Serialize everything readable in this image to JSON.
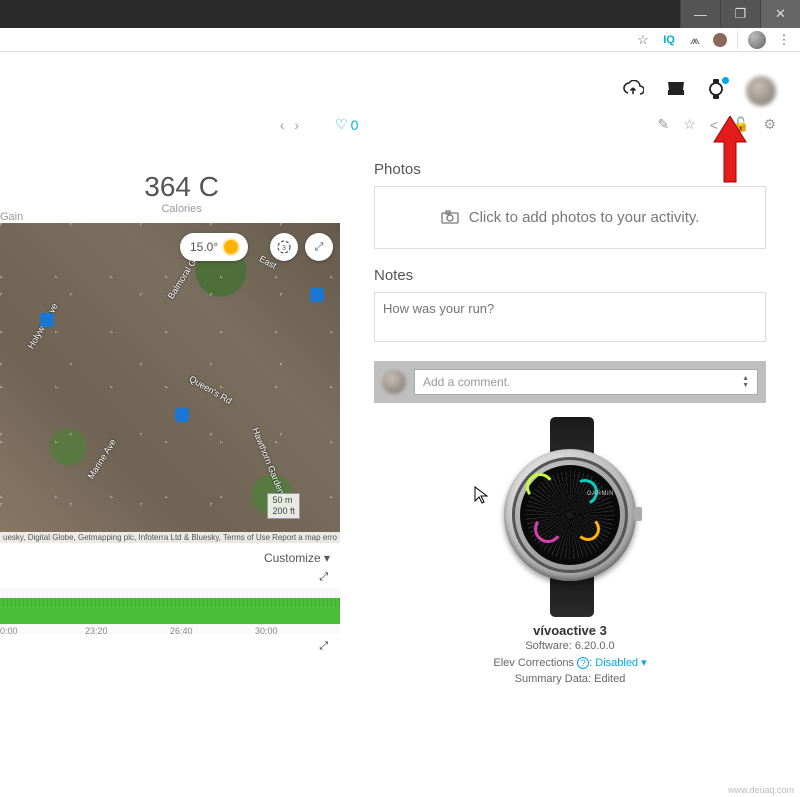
{
  "window": {
    "min": "—",
    "max": "❐",
    "close": "✕"
  },
  "browser": {
    "star": "☆",
    "iq": "IQ",
    "mtn": "⩕",
    "menu": "⋮"
  },
  "header": {},
  "actions": {
    "prev": "‹",
    "next": "›",
    "likes": "0"
  },
  "stats": {
    "calories_value": "364 C",
    "calories_label": "Calories",
    "gain_label": "Gain"
  },
  "map": {
    "temp": "15.0°",
    "streets": {
      "holywell": "Holywell Ave",
      "marine": "Marine Ave",
      "balmoral": "Balmoral Gardens",
      "queens": "Queen's Rd",
      "hawthorn": "Hawthorn Gardens",
      "east": "East"
    },
    "scale_top": "50 m",
    "scale_bot": "200 ft",
    "attrib_left": "uesky, Digital Globe, Getmapping plc, Infoterra Ltd & Bluesky,",
    "attrib_mid": "Terms of Use",
    "attrib_right": "Report a map erro",
    "customize": "Customize ▾"
  },
  "chart_data": {
    "type": "area",
    "x": [
      "0:00",
      "23:20",
      "26:40",
      "30:00"
    ],
    "values": [
      22,
      21,
      22,
      23,
      21,
      22,
      24,
      22,
      21,
      23
    ],
    "ylim": [
      0,
      40
    ]
  },
  "chart": {
    "ticks": [
      "0:00",
      "23:20",
      "26:40",
      "30:00"
    ]
  },
  "photos": {
    "title": "Photos",
    "cta": "Click to add photos to your activity."
  },
  "notes": {
    "title": "Notes",
    "placeholder": "How was your run?"
  },
  "comment": {
    "placeholder": "Add a comment."
  },
  "device": {
    "brand": "GARMIN",
    "name": "vívoactive 3",
    "software_label": "Software:",
    "software_value": "6.20.0.0",
    "elev_label": "Elev Corrections",
    "elev_value": "Disabled ▾",
    "summary_label": "Summary Data:",
    "summary_value": "Edited"
  },
  "watermark": "www.deuaq.com"
}
